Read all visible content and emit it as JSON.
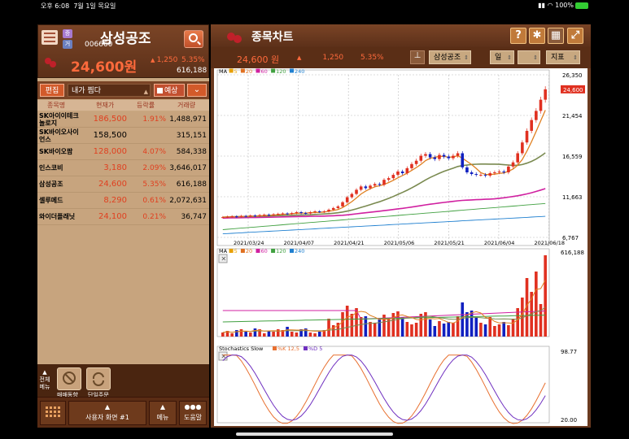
{
  "status": {
    "time": "오후 6:08",
    "date": "7월 1일 목요일",
    "battery": "100%"
  },
  "left": {
    "tags": [
      "증",
      "거"
    ],
    "name": "삼성공조",
    "code": "006660",
    "price": "24,600원",
    "change": "1,250",
    "pct": "5.35%",
    "volume": "616,188",
    "edit_label": "편집",
    "group": "내가 찜다",
    "predict_label": "예상",
    "headers": [
      "종목명",
      "현재가",
      "등락률",
      "거래량"
    ],
    "rows": [
      {
        "name": "SK아이이테크놀로지",
        "price": "186,500",
        "rate": "1.91%",
        "vol": "1,488,971",
        "color": "#e04020"
      },
      {
        "name": "SK바이오사이언스",
        "price": "158,500",
        "rate": "",
        "vol": "315,151",
        "color": "#000000"
      },
      {
        "name": "SK바이오팜",
        "price": "128,000",
        "rate": "4.07%",
        "vol": "584,338",
        "color": "#e04020"
      },
      {
        "name": "인스코비",
        "price": "3,180",
        "rate": "2.09%",
        "vol": "3,646,017",
        "color": "#e04020"
      },
      {
        "name": "삼성공조",
        "price": "24,600",
        "rate": "5.35%",
        "vol": "616,188",
        "color": "#e04020"
      },
      {
        "name": "셀루메드",
        "price": "8,290",
        "rate": "0.61%",
        "vol": "2,072,631",
        "color": "#e04020"
      },
      {
        "name": "와이더플래닛",
        "price": "24,100",
        "rate": "0.21%",
        "vol": "36,747",
        "color": "#e04020"
      }
    ],
    "footer": {
      "expand": "전체메뉴",
      "btn1": "매매동향",
      "btn2": "단일주문",
      "screen": "사용자 화면 #1",
      "menu": "메뉴",
      "help": "도움말"
    }
  },
  "right": {
    "title": "종목차트",
    "price": "24,600 원",
    "change": "1,250",
    "pct": "5.35%",
    "stock_select": "삼성공조",
    "period_select": "일",
    "indicator_label": "지표"
  },
  "chart_data": {
    "type": "candlestick",
    "price_axis": [
      "26,350",
      "21,454",
      "16,559",
      "11,663",
      "6,767"
    ],
    "current_price_tag": "24,600",
    "dates": [
      "2021/03/24",
      "2021/04/07",
      "2021/04/21",
      "2021/05/06",
      "2021/05/21",
      "2021/06/04",
      "2021/06/18"
    ],
    "ma_legend": [
      {
        "label": "MA",
        "color": "#000000"
      },
      {
        "label": "5",
        "color": "#e8a000"
      },
      {
        "label": "20",
        "color": "#e07020"
      },
      {
        "label": "60",
        "color": "#d020a0"
      },
      {
        "label": "120",
        "color": "#40a040"
      },
      {
        "label": "240",
        "color": "#2080d0"
      }
    ],
    "volume_axis": [
      "616,188"
    ],
    "stoch_title": "Stochastics Slow",
    "stoch_legend": [
      {
        "label": "%K 12,5",
        "color": "#e87030"
      },
      {
        "label": "%D 5",
        "color": "#7030c0"
      }
    ],
    "stoch_axis": [
      "98.77",
      "20.00"
    ],
    "closes": [
      9200,
      9250,
      9300,
      9250,
      9350,
      9300,
      9400,
      9350,
      9450,
      9500,
      9450,
      9550,
      9600,
      9650,
      9600,
      9700,
      9800,
      9700,
      9650,
      9800,
      9900,
      9850,
      9900,
      10100,
      10300,
      10500,
      11000,
      11600,
      12000,
      12500,
      12900,
      12700,
      13000,
      13200,
      13100,
      13700,
      13900,
      14300,
      14700,
      14500,
      15100,
      15600,
      16000,
      16600,
      16800,
      16400,
      16200,
      16700,
      16500,
      16300,
      16600,
      16900,
      15200,
      14600,
      14400,
      14300,
      14300,
      14200,
      14500,
      14600,
      14700,
      14600,
      15300,
      15800,
      16900,
      18200,
      19600,
      20900,
      22000,
      23350,
      24600
    ],
    "volumes": [
      5,
      7,
      4,
      8,
      9,
      6,
      5,
      10,
      9,
      4,
      7,
      6,
      9,
      8,
      12,
      6,
      5,
      9,
      10,
      5,
      4,
      6,
      8,
      22,
      14,
      17,
      30,
      38,
      28,
      35,
      24,
      25,
      18,
      17,
      21,
      27,
      22,
      29,
      31,
      24,
      18,
      15,
      17,
      28,
      30,
      21,
      13,
      19,
      16,
      18,
      17,
      25,
      42,
      30,
      32,
      24,
      17,
      15,
      24,
      13,
      15,
      18,
      14,
      22,
      35,
      48,
      72,
      55,
      80,
      40,
      100
    ]
  }
}
